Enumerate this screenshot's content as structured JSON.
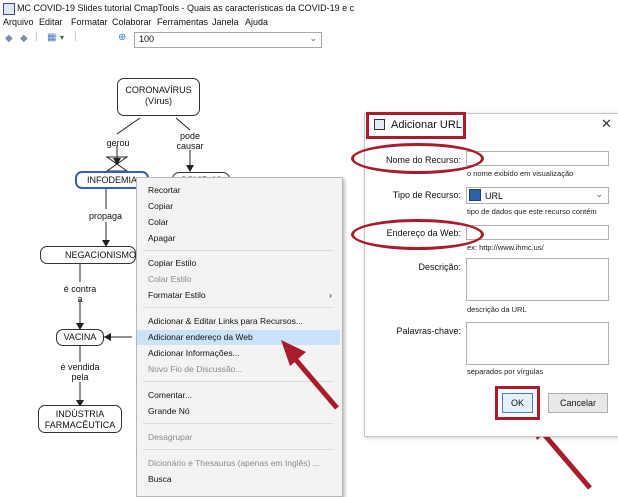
{
  "window": {
    "title": "MC COVID-19 Slides tutorial CmapTools - Quais as características da COVID-19 e c"
  },
  "menubar": [
    "Arquivo",
    "Editar",
    "Formatar",
    "Colaborar",
    "Ferramentas",
    "Janela",
    "Ajuda"
  ],
  "toolbar": {
    "zoom": "100"
  },
  "map": {
    "nodes": {
      "coronavirus": "CORONAVÍRUS\n(Vírus)",
      "infodemia": "INFODEMIA",
      "covid": "COVID-19",
      "negacionismo": "NEGACIONISMO",
      "vacina": "VACINA",
      "industria": "INDÚSTRIA\nFARMACÊUTICA"
    },
    "links": {
      "gerou": "gerou",
      "pode_causar": "pode\ncausar",
      "propaga": "propaga",
      "e_contra": "é contra\na",
      "e_vendida_pela": "é vendida\npela"
    }
  },
  "context_menu": {
    "items": [
      {
        "label": "Recortar",
        "disabled": false
      },
      {
        "label": "Copiar",
        "disabled": false
      },
      {
        "label": "Colar",
        "disabled": false
      },
      {
        "label": "Apagar",
        "disabled": false
      },
      {
        "label": "Copiar Estilo",
        "disabled": false
      },
      {
        "label": "Colar Estilo",
        "disabled": true
      },
      {
        "label": "Formatar Estilo",
        "disabled": false,
        "submenu": true
      },
      {
        "label": "Adicionar & Editar Links para Recursos...",
        "disabled": false
      },
      {
        "label": "Adicionar endereço da Web",
        "disabled": false,
        "highlighted": true
      },
      {
        "label": "Adicionar Informações...",
        "disabled": false
      },
      {
        "label": "Novo Fio de Discussão...",
        "disabled": true
      },
      {
        "label": "Comentar...",
        "disabled": false
      },
      {
        "label": "Grande Nó",
        "disabled": false
      },
      {
        "label": "Desagrupar",
        "disabled": true
      },
      {
        "label": "Dicionário e Thesaurus (apenas em Inglês) ...",
        "disabled": true
      },
      {
        "label": "Busca",
        "disabled": false
      }
    ],
    "submenu_arrow": "›"
  },
  "dialog": {
    "title": "Adicionar URL",
    "close": "✕",
    "resource_name_label": "Nome do Recurso:",
    "resource_name_value": "",
    "resource_name_hint": "o nome exibido em visualização",
    "resource_type_label": "Tipo de Recurso:",
    "resource_type_value": "URL",
    "resource_type_hint": "tipo de dados que este recurso contém",
    "web_address_label": "Endereço da Web:",
    "web_address_value": "",
    "web_address_hint": "ex: http://www.ihmc.us/",
    "description_label": "Descrição:",
    "description_value": "",
    "description_hint": "descrição da URL",
    "keywords_label": "Palavras-chave:",
    "keywords_value": "",
    "keywords_hint": "separados por vírgulas",
    "ok": "OK",
    "cancel": "Cancelar"
  },
  "colors": {
    "annotation_red": "#a81c2d",
    "highlight_blue": "#cbe3f8"
  }
}
